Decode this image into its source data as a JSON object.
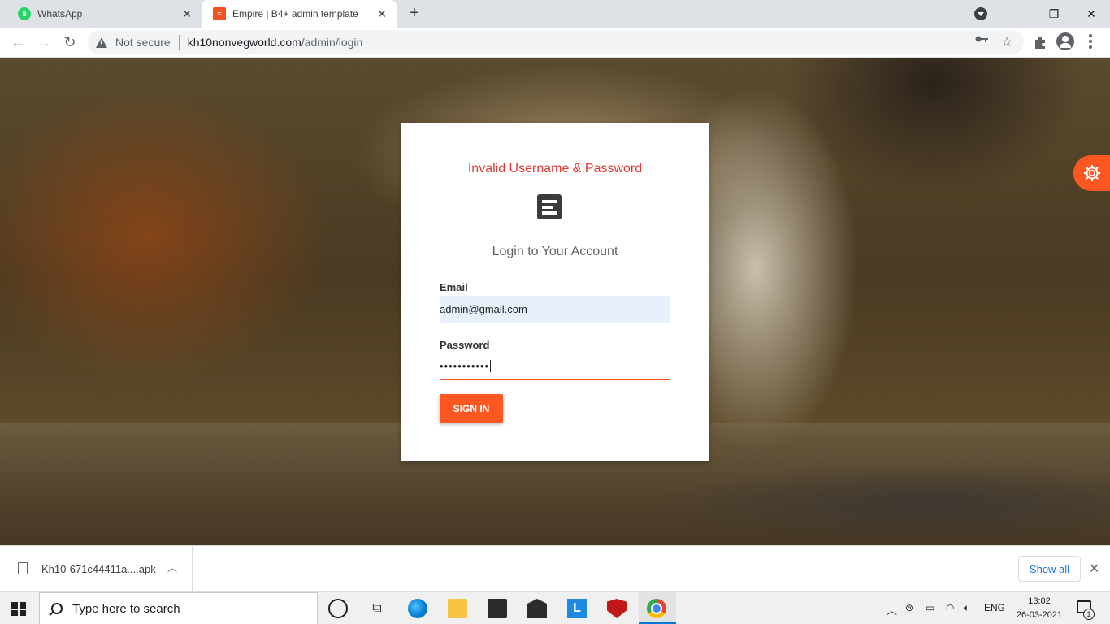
{
  "browser": {
    "tabs": [
      {
        "title": "WhatsApp",
        "favicon": "whatsapp-icon",
        "active": false,
        "badge": "8"
      },
      {
        "title": "Empire | B4+ admin template",
        "favicon": "empire-logo-icon",
        "active": true
      }
    ],
    "new_tab": "+",
    "security_label": "Not secure",
    "url_host": "kh10nonvegworld.com",
    "url_path": "/admin/login"
  },
  "login": {
    "error": "Invalid Username & Password",
    "heading": "Login to Your Account",
    "email_label": "Email",
    "email_value": "admin@gmail.com",
    "password_label": "Password",
    "password_value": "•••••••••••",
    "submit_label": "SIGN IN",
    "accent_color": "#ff5722",
    "error_color": "#e53935"
  },
  "downloads": {
    "file_name": "Kh10-671c44411a....apk",
    "show_all": "Show all"
  },
  "taskbar": {
    "search_placeholder": "Type here to search",
    "language": "ENG",
    "time": "13:02",
    "date": "26-03-2021",
    "notification_count": "1"
  }
}
